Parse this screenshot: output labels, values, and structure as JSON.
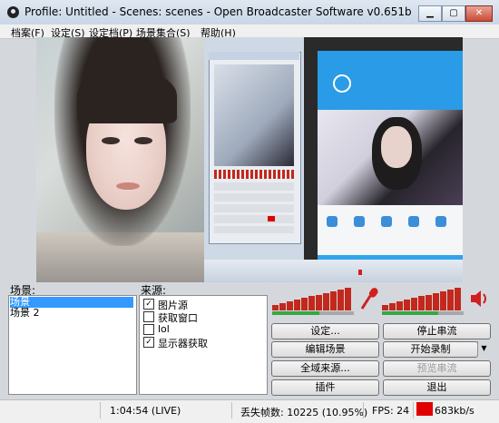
{
  "window": {
    "title": "Profile: Untitled - Scenes: scenes - Open Broadcaster Software v0.651b"
  },
  "menu": [
    "档案(F)",
    "设定(S)",
    "设定档(P)",
    "场景集合(S)",
    "帮助(H)"
  ],
  "scenes": {
    "label": "场景:",
    "items": [
      "场景",
      "场景 2"
    ],
    "selected_index": 0
  },
  "sources": {
    "label": "来源:",
    "items": [
      {
        "label": "图片源",
        "checked": true
      },
      {
        "label": "获取窗口",
        "checked": false
      },
      {
        "label": "lol",
        "checked": false
      },
      {
        "label": "显示器获取",
        "checked": true
      }
    ]
  },
  "buttons": {
    "settings": "设定...",
    "stop_stream": "停止串流",
    "edit_scene": "编辑场景",
    "start_record": "开始录制",
    "global_sources": "全域来源...",
    "preview_stream": "预览串流",
    "plugins": "插件",
    "exit": "退出"
  },
  "status": {
    "time": "1:04:54 (LIVE)",
    "dropped_frames": "丢失帧数: 10225 (10.95%)",
    "fps": "FPS: 24",
    "bitrate": "683kb/s"
  },
  "colors": {
    "meter_red": "#c2281c",
    "meter_green": "#35a845",
    "bitrate_status": "#e00000",
    "selection": "#3399ff"
  },
  "icons": {
    "mic": "microphone-icon",
    "speaker": "speaker-icon"
  }
}
